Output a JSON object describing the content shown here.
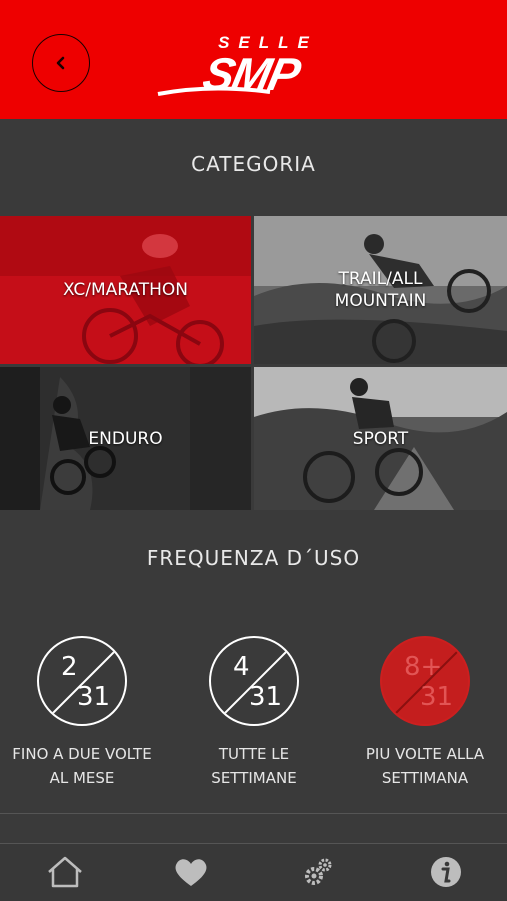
{
  "header": {
    "brand_top": "SELLE",
    "brand_main": "SMP",
    "back_icon": "chevron-left-icon",
    "colors": {
      "header_bg": "#ee0000",
      "accent": "#c41e1e"
    }
  },
  "categoria": {
    "title": "CATEGORIA",
    "tiles": [
      {
        "label": "XC/MARATHON",
        "selected": true
      },
      {
        "label": "TRAIL/ALL\nMOUNTAIN",
        "selected": false
      },
      {
        "label": "ENDURO",
        "selected": false
      },
      {
        "label": "SPORT",
        "selected": false
      }
    ]
  },
  "frequenza": {
    "title": "FREQUENZA D´USO",
    "options": [
      {
        "top": "2",
        "bottom": "31",
        "label": "FINO A DUE VOLTE\nAL MESE",
        "selected": false
      },
      {
        "top": "4",
        "bottom": "31",
        "label": "TUTTE LE\nSETTIMANE",
        "selected": false
      },
      {
        "top": "8+",
        "bottom": "31",
        "label": "PIU VOLTE ALLA\nSETTIMANA",
        "selected": true
      }
    ]
  },
  "tabbar": {
    "items": [
      {
        "icon": "home-icon"
      },
      {
        "icon": "heart-icon"
      },
      {
        "icon": "gears-icon"
      },
      {
        "icon": "info-icon"
      }
    ]
  }
}
